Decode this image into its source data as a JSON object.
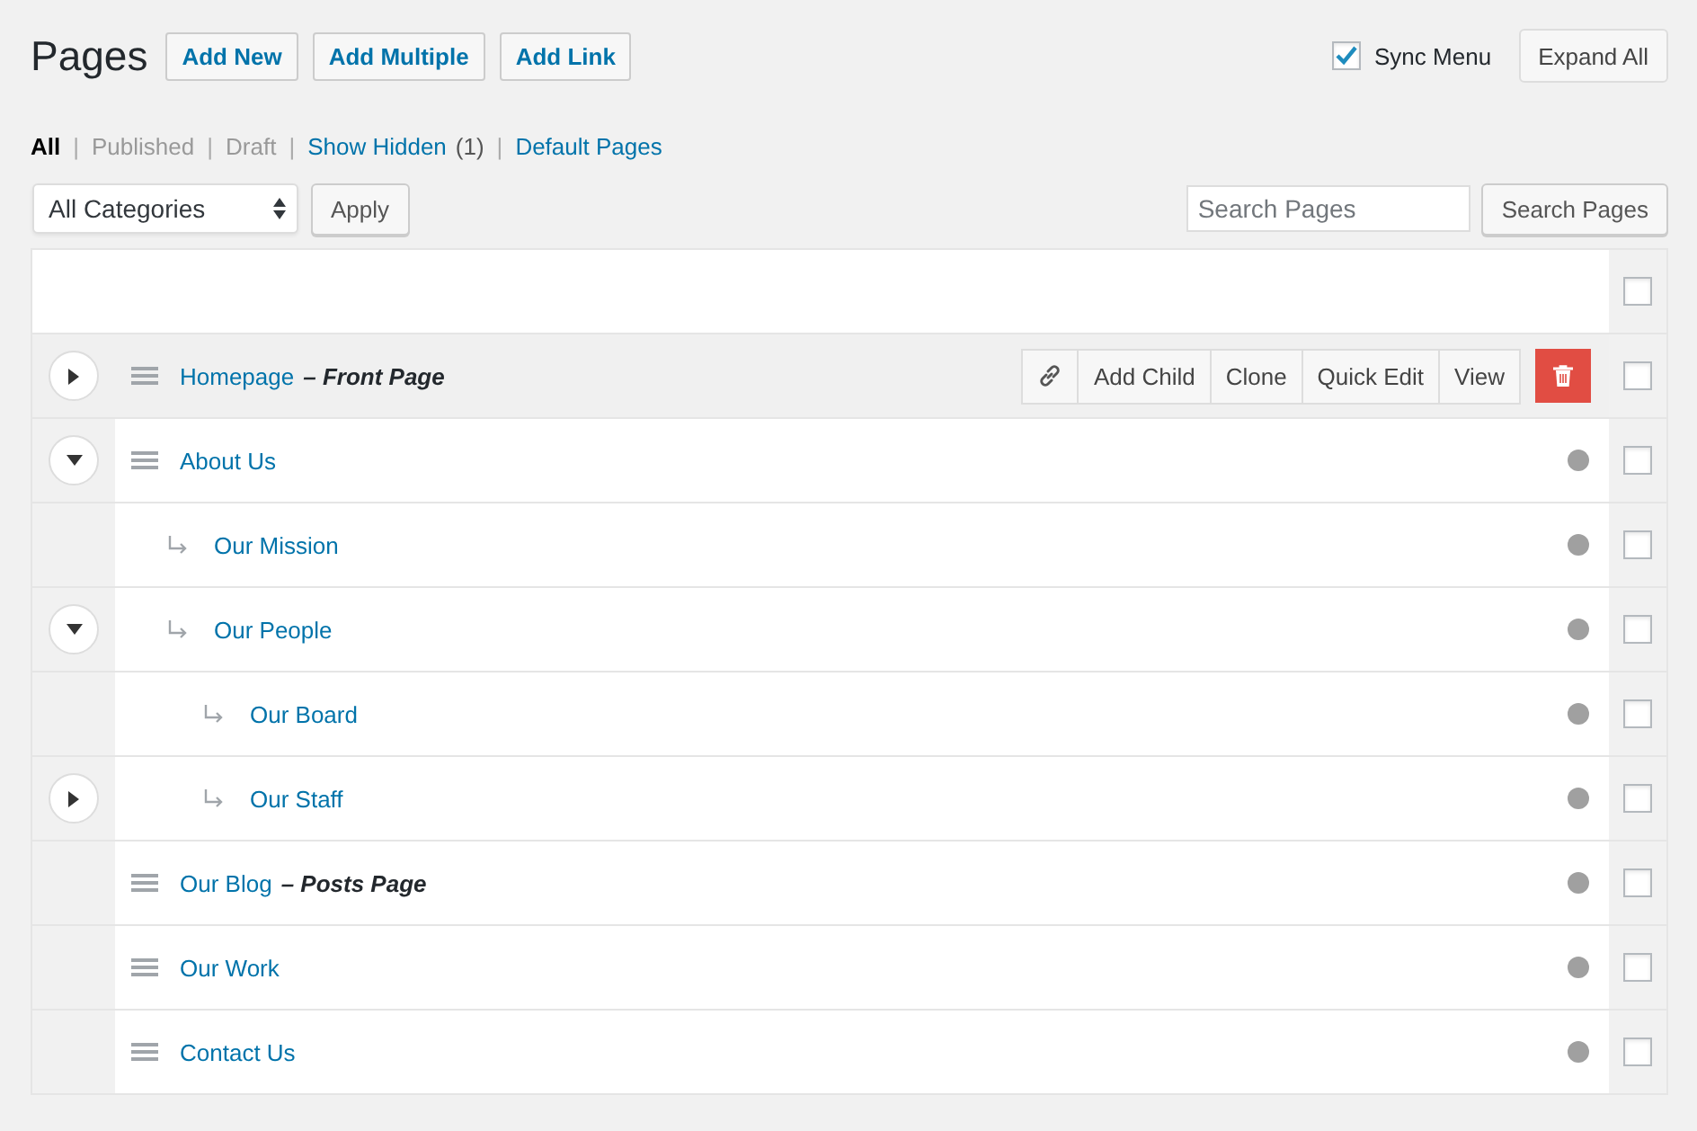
{
  "header": {
    "title": "Pages",
    "buttons": [
      "Add New",
      "Add Multiple",
      "Add Link"
    ],
    "sync_menu": {
      "label": "Sync Menu",
      "checked": true
    },
    "expand_button": "Expand All"
  },
  "filters": [
    {
      "label": "All",
      "selected": true,
      "disabled": false
    },
    {
      "separator": "|",
      "label": "Published",
      "selected": false,
      "disabled": true
    },
    {
      "separator": "|",
      "label": "Draft",
      "selected": false,
      "disabled": true
    },
    {
      "separator": "|",
      "label": "Show Hidden",
      "count": "(1)",
      "selected": false,
      "disabled": false
    },
    {
      "separator": "|",
      "label": "Default Pages",
      "selected": false,
      "disabled": false
    }
  ],
  "category_select": {
    "value": "All Categories"
  },
  "apply_button": "Apply",
  "search": {
    "placeholder": "Search Pages",
    "button": "Search Pages"
  },
  "list": {
    "header_checked": false,
    "pages": [
      {
        "title": "Homepage",
        "suffix": "– Front Page",
        "expanded": false,
        "highlighted": true,
        "checked": false,
        "actions": [
          {
            "kind": "link"
          },
          {
            "kind": "text",
            "label": "Add Child"
          },
          {
            "kind": "text",
            "label": "Clone"
          },
          {
            "kind": "text",
            "label": "Quick Edit"
          },
          {
            "kind": "text",
            "label": "View"
          },
          {
            "kind": "trash"
          }
        ]
      },
      {
        "title": "About Us",
        "expanded": true,
        "highlighted": false,
        "checked": false,
        "color": "#a0a0a0",
        "children": [
          {
            "title": "Our Mission",
            "highlighted": false,
            "checked": false,
            "color": "#a0a0a0"
          },
          {
            "title": "Our People",
            "expanded": true,
            "highlighted": false,
            "checked": false,
            "color": "#a0a0a0",
            "children": [
              {
                "title": "Our Board",
                "highlighted": false,
                "checked": false,
                "color": "#a0a0a0"
              },
              {
                "title": "Our Staff",
                "expanded": false,
                "highlighted": false,
                "checked": false,
                "color": "#a0a0a0"
              }
            ]
          }
        ]
      },
      {
        "title": "Our Blog",
        "suffix": "– Posts Page",
        "highlighted": false,
        "checked": false,
        "color": "#a0a0a0"
      },
      {
        "title": "Our Work",
        "highlighted": false,
        "checked": false,
        "color": "#a0a0a0"
      },
      {
        "title": "Contact Us",
        "highlighted": false,
        "checked": false,
        "color": "#a0a0a0"
      }
    ]
  }
}
